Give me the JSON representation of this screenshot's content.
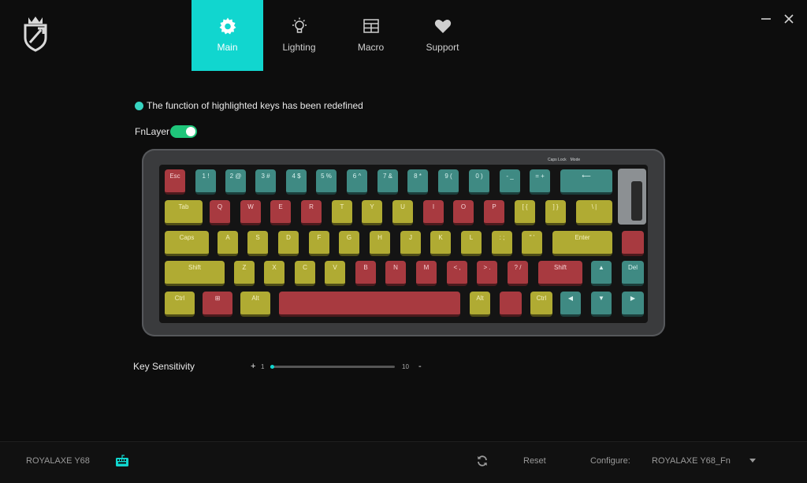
{
  "nav": {
    "tabs": [
      {
        "label": "Main",
        "icon": "gear-icon",
        "active": true
      },
      {
        "label": "Lighting",
        "icon": "lightbulb-icon",
        "active": false
      },
      {
        "label": "Macro",
        "icon": "grid-icon",
        "active": false
      },
      {
        "label": "Support",
        "icon": "heart-icon",
        "active": false
      }
    ]
  },
  "notice": {
    "text": "The function of highlighted keys has been redefined"
  },
  "fnlayer": {
    "label": "FnLayer",
    "enabled": true
  },
  "keyboard_top": {
    "caps_lock": "Caps Lock",
    "mode": "Mode"
  },
  "keys": {
    "row1": [
      "Esc",
      "1 !",
      "2 @",
      "3 #",
      "4 $",
      "5 %",
      "6 ^",
      "7 &",
      "8 *",
      "9 (",
      "0 )",
      "- _",
      "= +",
      "⟵"
    ],
    "row2": [
      "Tab",
      "Q",
      "W",
      "E",
      "R",
      "T",
      "Y",
      "U",
      "I",
      "O",
      "P",
      "[ {",
      "] }",
      "\\ |"
    ],
    "row3": [
      "Caps",
      "A",
      "S",
      "D",
      "F",
      "G",
      "H",
      "J",
      "K",
      "L",
      ": ;",
      "\" '",
      "Enter",
      ""
    ],
    "row4": [
      "Shift",
      "Z",
      "X",
      "C",
      "V",
      "B",
      "N",
      "M",
      "< ,",
      "> .",
      "? /",
      "Shift",
      "▲",
      "Del"
    ],
    "row5": [
      "Ctrl",
      "⊞",
      "Alt",
      "",
      "Alt",
      "",
      "Ctrl",
      "◀",
      "▼",
      "▶"
    ]
  },
  "sensitivity": {
    "label": "Key Sensitivity",
    "plus": "+",
    "min": "1",
    "max": "10",
    "minus": "-",
    "value": 1
  },
  "footer": {
    "device": "ROYALAXE Y68",
    "reset": "Reset",
    "configure_label": "Configure:",
    "configure_value": "ROYALAXE Y68_Fn"
  },
  "colors": {
    "accent": "#11d6cf",
    "key_teal": "#3f8a83",
    "key_yellow": "#b0ab33",
    "key_red": "#a83a40",
    "toggle_on": "#1fc57a"
  }
}
